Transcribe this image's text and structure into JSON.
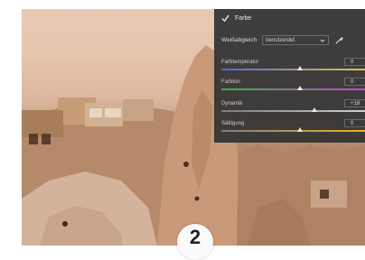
{
  "panel": {
    "section_title": "Farbe",
    "white_balance": {
      "label": "Weißabgleich",
      "value": "benutzerdef."
    },
    "sliders": [
      {
        "label": "Farbtemperatur",
        "value": "0",
        "level": 0.55
      },
      {
        "label": "Farbton",
        "value": "0",
        "level": 0.55
      },
      {
        "label": "Dynamik",
        "value": "+18",
        "level": 0.65
      },
      {
        "label": "Sättigung",
        "value": "0",
        "level": 0.55
      }
    ]
  },
  "step_badge": "2",
  "colors": {
    "panel_bg": "#343434",
    "temp_track": [
      "#4a68d8",
      "#d8c84a"
    ],
    "tint_track": [
      "#38b44a",
      "#c844c8"
    ],
    "vibrance_track": [
      "#7a7a7a",
      "#d0d0d0"
    ],
    "saturation_track": [
      "#808080",
      "#f0b020"
    ]
  }
}
